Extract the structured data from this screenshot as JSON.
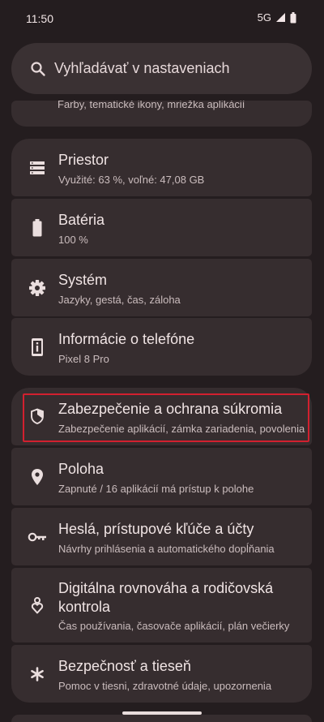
{
  "status": {
    "time": "11:50",
    "network": "5G"
  },
  "search": {
    "placeholder": "Vyhľadávať v nastaveniach"
  },
  "partial_item": {
    "subtitle": "Farby, tematické ikony, mriežka aplikácií"
  },
  "group1": [
    {
      "title": "Priestor",
      "subtitle": "Využité: 63 %, voľné: 47,08 GB",
      "icon": "storage-icon"
    },
    {
      "title": "Batéria",
      "subtitle": "100 %",
      "icon": "battery-icon"
    },
    {
      "title": "Systém",
      "subtitle": "Jazyky, gestá, čas, záloha",
      "icon": "gear-icon"
    },
    {
      "title": "Informácie o telefóne",
      "subtitle": "Pixel 8 Pro",
      "icon": "phone-info-icon"
    }
  ],
  "group2": [
    {
      "title": "Zabezpečenie a ochrana súkromia",
      "subtitle": "Zabezpečenie aplikácií, zámka zariadenia, povolenia",
      "icon": "shield-icon"
    },
    {
      "title": "Poloha",
      "subtitle": "Zapnuté / 16 aplikácií má prístup k polohe",
      "icon": "location-pin-icon"
    },
    {
      "title": "Heslá, prístupové kľúče a účty",
      "subtitle": "Návrhy prihlásenia a automatického dopĺňania",
      "icon": "key-icon"
    },
    {
      "title": "Digitálna rovnováha a rodičovská kontrola",
      "subtitle": "Čas používania, časovače aplikácií, plán večierky",
      "icon": "wellbeing-icon"
    },
    {
      "title": "Bezpečnosť a tieseň",
      "subtitle": "Pomoc v tiesni, zdravotné údaje, upozornenia",
      "icon": "asterisk-icon"
    }
  ]
}
